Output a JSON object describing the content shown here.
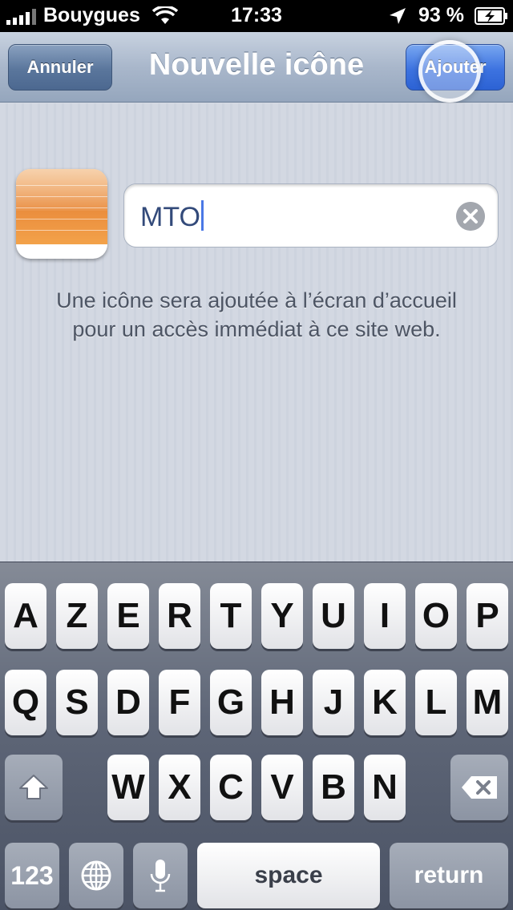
{
  "status_bar": {
    "carrier": "Bouygues",
    "time": "17:33",
    "battery": "93 %"
  },
  "nav": {
    "cancel_label": "Annuler",
    "title": "Nouvelle icône",
    "add_label": "Ajouter"
  },
  "form": {
    "name_value": "MTO"
  },
  "info": {
    "line1": "Une icône sera ajoutée à l’écran d’accueil",
    "line2": "pour un accès immédiat à ce site web."
  },
  "keyboard": {
    "row1": [
      "A",
      "Z",
      "E",
      "R",
      "T",
      "Y",
      "U",
      "I",
      "O",
      "P"
    ],
    "row2": [
      "Q",
      "S",
      "D",
      "F",
      "G",
      "H",
      "J",
      "K",
      "L",
      "M"
    ],
    "row3": [
      "W",
      "X",
      "C",
      "V",
      "B",
      "N"
    ],
    "numbers_label": "123",
    "space_label": "space",
    "return_label": "return"
  },
  "colors": {
    "accent_blue": "#3d73e0",
    "cursor": "#4a78e6"
  }
}
